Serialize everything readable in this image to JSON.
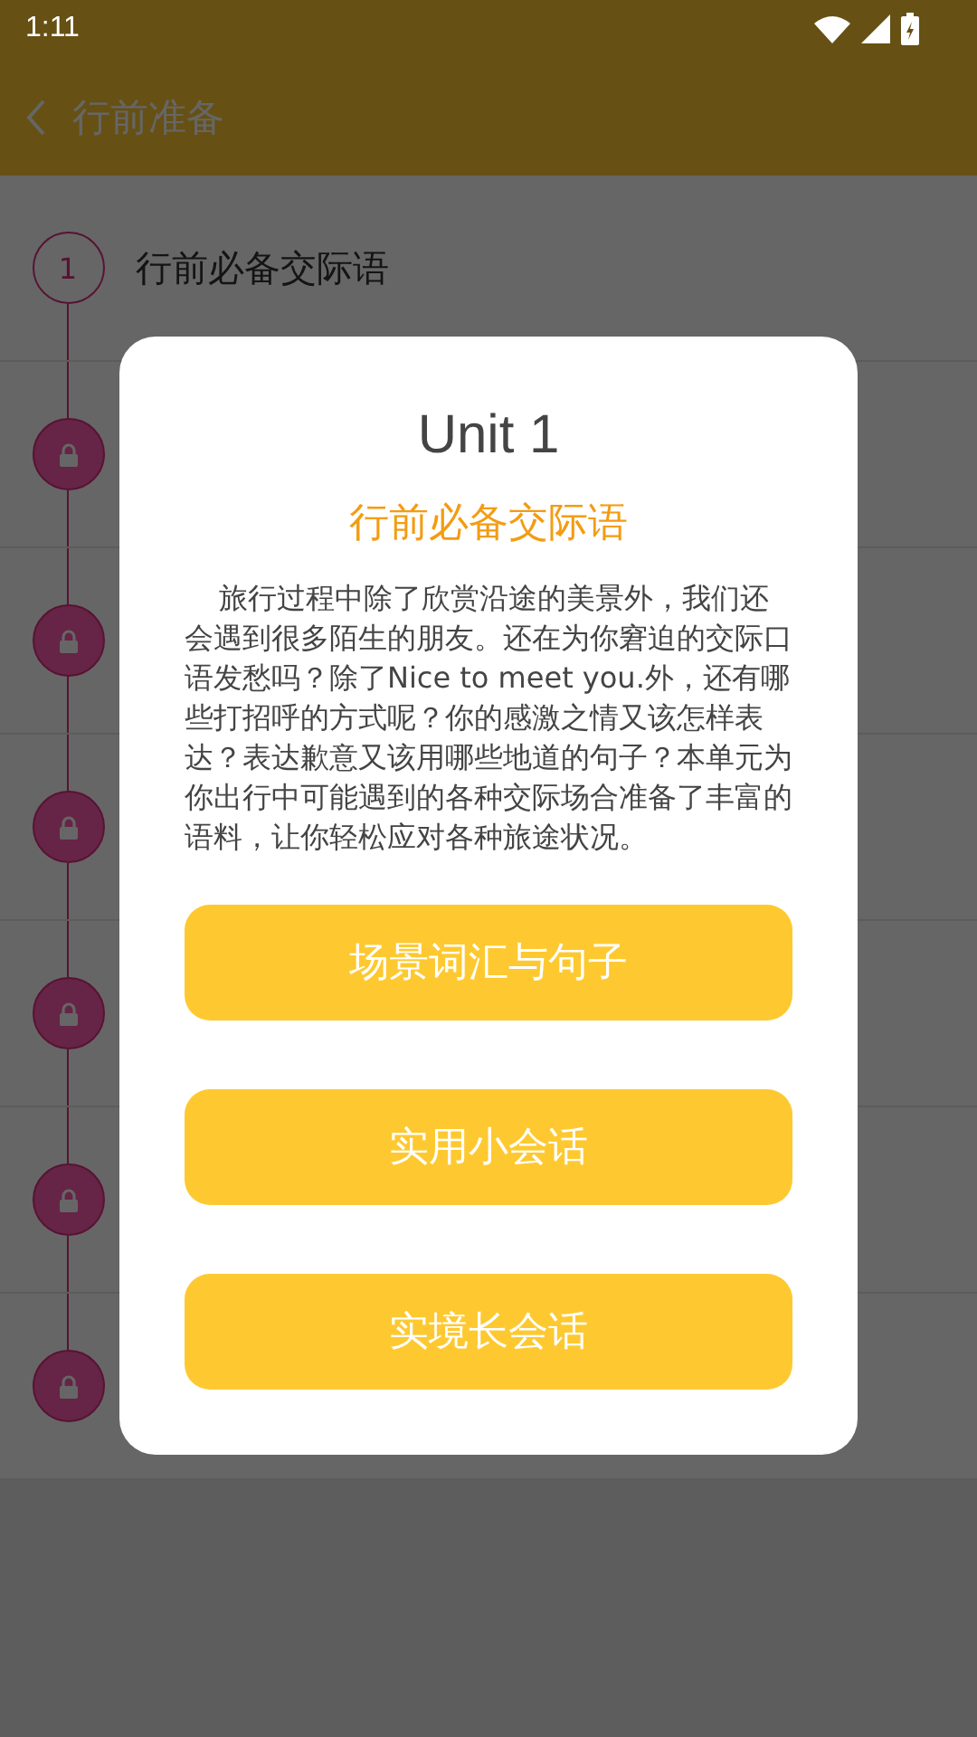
{
  "status_bar": {
    "time": "1:11"
  },
  "app_bar": {
    "title": "行前准备"
  },
  "lessons": [
    {
      "kind": "numbered",
      "number": "1",
      "title": "行前必备交际语"
    },
    {
      "kind": "locked"
    },
    {
      "kind": "locked"
    },
    {
      "kind": "locked"
    },
    {
      "kind": "locked"
    },
    {
      "kind": "locked"
    },
    {
      "kind": "locked"
    }
  ],
  "dialog": {
    "title": "Unit 1",
    "subtitle": "行前必备交际语",
    "description": "旅行过程中除了欣赏沿途的美景外，我们还会遇到很多陌生的朋友。还在为你窘迫的交际口语发愁吗？除了Nice to meet you.外，还有哪些打招呼的方式呢？你的感激之情又该怎样表达？表达歉意又该用哪些地道的句子？本单元为你出行中可能遇到的各种交际场合准备了丰富的语料，让你轻松应对各种旅途状况。",
    "buttons": [
      "场景词汇与句子",
      "实用小会话",
      "实境长会话"
    ]
  }
}
